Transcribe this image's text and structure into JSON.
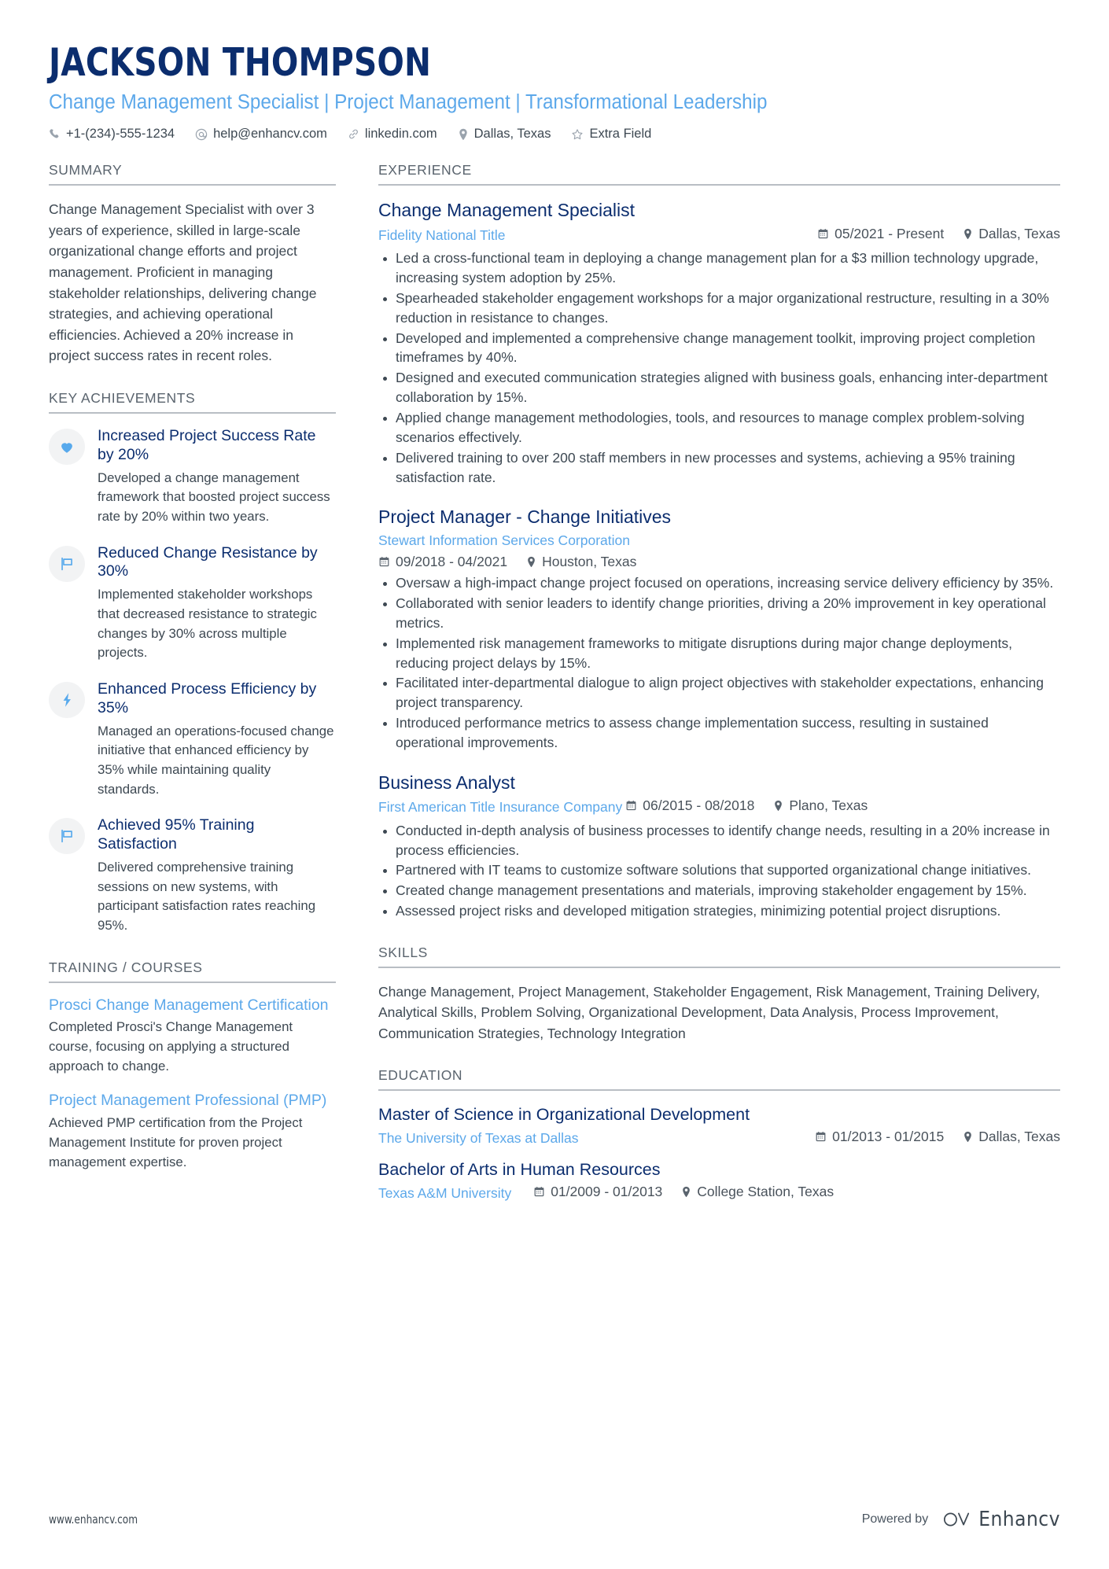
{
  "header": {
    "name": "JACKSON THOMPSON",
    "headline": "Change Management Specialist | Project Management | Transformational Leadership",
    "contacts": [
      {
        "icon": "phone-icon",
        "text": "+1-(234)-555-1234"
      },
      {
        "icon": "email-icon",
        "text": "help@enhancv.com"
      },
      {
        "icon": "link-icon",
        "text": "linkedin.com"
      },
      {
        "icon": "location-icon",
        "text": "Dallas, Texas"
      },
      {
        "icon": "star-icon",
        "text": "Extra Field"
      }
    ]
  },
  "colors": {
    "name_navy": "#0b2d6e",
    "accent_blue": "#5ca8ea",
    "body_text": "#3d4852",
    "section_rule": "#b9bec4",
    "icon_bubble": "#f2f3f4"
  },
  "summary": {
    "title": "SUMMARY",
    "text": "Change Management Specialist with over 3 years of experience, skilled in large-scale organizational change efforts and project management. Proficient in managing stakeholder relationships, delivering change strategies, and achieving operational efficiencies. Achieved a 20% increase in project success rates in recent roles."
  },
  "achievements": {
    "title": "KEY ACHIEVEMENTS",
    "items": [
      {
        "icon": "heart-icon",
        "title": "Increased Project Success Rate by 20%",
        "desc": "Developed a change management framework that boosted project success rate by 20% within two years."
      },
      {
        "icon": "flag-icon",
        "title": "Reduced Change Resistance by 30%",
        "desc": "Implemented stakeholder workshops that decreased resistance to strategic changes by 30% across multiple projects."
      },
      {
        "icon": "bolt-icon",
        "title": "Enhanced Process Efficiency by 35%",
        "desc": "Managed an operations-focused change initiative that enhanced efficiency by 35% while maintaining quality standards."
      },
      {
        "icon": "flag-icon",
        "title": "Achieved 95% Training Satisfaction",
        "desc": "Delivered comprehensive training sessions on new systems, with participant satisfaction rates reaching 95%."
      }
    ]
  },
  "training": {
    "title": "TRAINING / COURSES",
    "items": [
      {
        "title": "Prosci Change Management Certification",
        "desc": "Completed Prosci's Change Management course, focusing on applying a structured approach to change."
      },
      {
        "title": "Project Management Professional (PMP)",
        "desc": "Achieved PMP certification from the Project Management Institute for proven project management expertise."
      }
    ]
  },
  "experience": {
    "title": "EXPERIENCE",
    "jobs": [
      {
        "title": "Change Management Specialist",
        "company": "Fidelity National Title",
        "dates": "05/2021 - Present",
        "location": "Dallas, Texas",
        "meta_layout": "company-left-dates-right",
        "bullets": [
          "Led a cross-functional team in deploying a change management plan for a $3 million technology upgrade, increasing system adoption by 25%.",
          "Spearheaded stakeholder engagement workshops for a major organizational restructure, resulting in a 30% reduction in resistance to changes.",
          "Developed and implemented a comprehensive change management toolkit, improving project completion timeframes by 40%.",
          "Designed and executed communication strategies aligned with business goals, enhancing inter-department collaboration by 15%.",
          "Applied change management methodologies, tools, and resources to manage complex problem-solving scenarios effectively.",
          "Delivered training to over 200 staff members in new processes and systems, achieving a 95% training satisfaction rate."
        ]
      },
      {
        "title": "Project Manager - Change Initiatives",
        "company": "Stewart Information Services Corporation",
        "dates": "09/2018 - 04/2021",
        "location": "Houston, Texas",
        "meta_layout": "company-own-line",
        "bullets": [
          "Oversaw a high-impact change project focused on operations, increasing service delivery efficiency by 35%.",
          "Collaborated with senior leaders to identify change priorities, driving a 20% improvement in key operational metrics.",
          "Implemented risk management frameworks to mitigate disruptions during major change deployments, reducing project delays by 15%.",
          "Facilitated inter-departmental dialogue to align project objectives with stakeholder expectations, enhancing project transparency.",
          "Introduced performance metrics to assess change implementation success, resulting in sustained operational improvements."
        ]
      },
      {
        "title": "Business Analyst",
        "company": "First American Title Insurance Company",
        "dates": "06/2015 - 08/2018",
        "location": "Plano, Texas",
        "meta_layout": "company-inline-dates",
        "bullets": [
          "Conducted in-depth analysis of business processes to identify change needs, resulting in a 20% increase in process efficiencies.",
          "Partnered with IT teams to customize software solutions that supported organizational change initiatives.",
          "Created change management presentations and materials, improving stakeholder engagement by 15%.",
          "Assessed project risks and developed mitigation strategies, minimizing potential project disruptions."
        ]
      }
    ]
  },
  "skills": {
    "title": "SKILLS",
    "text": "Change Management, Project Management, Stakeholder Engagement, Risk Management, Training Delivery, Analytical Skills, Problem Solving, Organizational Development, Data Analysis, Process Improvement, Communication Strategies, Technology Integration"
  },
  "education": {
    "title": "EDUCATION",
    "items": [
      {
        "degree": "Master of Science in Organizational Development",
        "school": "The University of Texas at Dallas",
        "dates": "01/2013 - 01/2015",
        "location": "Dallas, Texas",
        "inline": false
      },
      {
        "degree": "Bachelor of Arts in Human Resources",
        "school": "Texas A&M University",
        "dates": "01/2009 - 01/2013",
        "location": "College Station, Texas",
        "inline": true
      }
    ]
  },
  "footer": {
    "url": "www.enhancv.com",
    "powered_by": "Powered by",
    "brand": "Enhancv"
  }
}
